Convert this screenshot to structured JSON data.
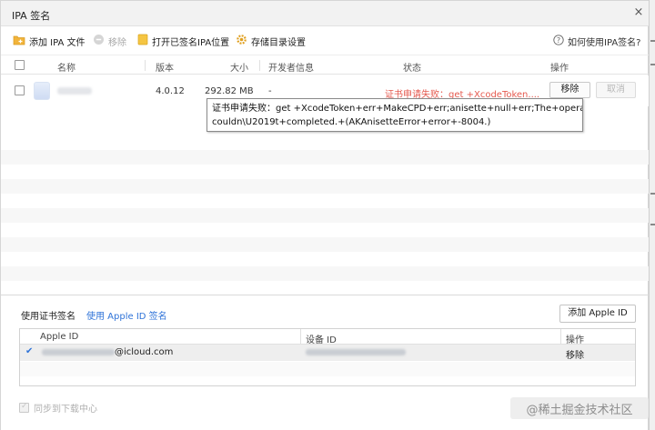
{
  "window": {
    "title": "IPA 签名",
    "close_glyph": "×"
  },
  "toolbar": {
    "add_ipa": {
      "label": "添加 IPA 文件",
      "icon": "folder-plus-icon",
      "color": "#f2b43b"
    },
    "remove": {
      "label": "移除",
      "icon": "remove-circle-icon"
    },
    "open_signed": {
      "label": "打开已签名IPA位置",
      "icon": "folder-icon"
    },
    "storage": {
      "label": "存储目录设置",
      "icon": "gear-icon"
    },
    "help": {
      "label": "如何使用IPA签名?",
      "icon": "question-circle-icon"
    }
  },
  "table": {
    "headers": [
      "名称",
      "版本",
      "大小",
      "开发者信息",
      "状态",
      "操作"
    ],
    "rows": [
      {
        "version": "4.0.12",
        "size": "292.82 MB",
        "developer": "-",
        "status": "证书申请失败：get +XcodeToken....",
        "action_remove": "移除",
        "action_cancel": "取消"
      }
    ]
  },
  "tooltip": {
    "line1": "证书申请失败：get +XcodeToken+err+MakeCPD+err;anisette+null+err;The+operation+",
    "line2": "couldn\\U2019t+completed.+(AKAnisetteError+error+-8004.)"
  },
  "signing": {
    "tab_cert": "使用证书签名",
    "tab_apple_id": "使用 Apple ID 签名",
    "add_apple_id": "添加 Apple ID",
    "headers": [
      "Apple ID",
      "设备 ID",
      "操作"
    ],
    "rows": [
      {
        "apple_id_suffix": "@icloud.com",
        "action": "移除"
      }
    ]
  },
  "footer": {
    "sync_label": "同步到下载中心",
    "watermark": "@稀土掘金技术社区"
  },
  "colors": {
    "error": "#e55a4f",
    "link": "#2f73d8",
    "accent_check": "#2f73d8"
  }
}
